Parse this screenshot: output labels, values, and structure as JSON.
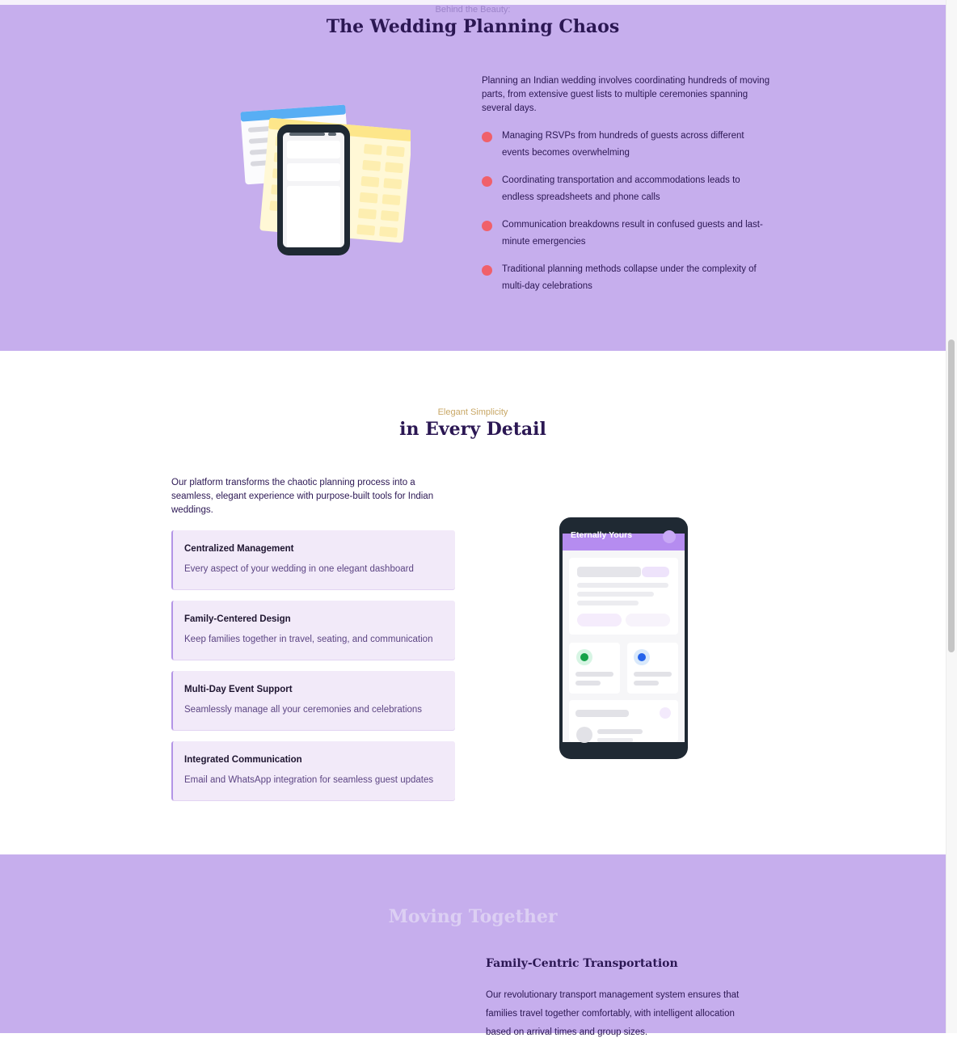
{
  "chaos": {
    "eyebrow": "Behind the Beauty:",
    "title": "The Wedding Planning Chaos",
    "intro": "Planning an Indian wedding involves coordinating hundreds of moving parts, from extensive guest lists to multiple ceremonies spanning several days.",
    "bullets": [
      "Managing RSVPs from hundreds of guests across different events becomes overwhelming",
      "Coordinating transportation and accommodations leads to endless spreadsheets and phone calls",
      "Communication breakdowns result in confused guests and last-minute emergencies",
      "Traditional planning methods collapse under the complexity of multi-day celebrations"
    ]
  },
  "detail": {
    "eyebrow": "Elegant Simplicity",
    "title": "in Every Detail",
    "intro": "Our platform transforms the chaotic planning process into a seamless, elegant experience with purpose-built tools for Indian weddings.",
    "features": [
      {
        "title": "Centralized Management",
        "desc": "Every aspect of your wedding in one elegant dashboard"
      },
      {
        "title": "Family-Centered Design",
        "desc": "Keep families together in travel, seating, and communication"
      },
      {
        "title": "Multi-Day Event Support",
        "desc": "Seamlessly manage all your ceremonies and celebrations"
      },
      {
        "title": "Integrated Communication",
        "desc": "Email and WhatsApp integration for seamless guest updates"
      }
    ],
    "phone_brand": "Eternally Yours"
  },
  "moving": {
    "title": "Moving Together",
    "transport_title": "Family-Centric Transportation",
    "transport_desc": "Our revolutionary transport management system ensures that families travel together comfortably, with intelligent allocation based on arrival times and group sizes."
  },
  "colors": {
    "section_lavender": "#c6aeed",
    "accent_gold": "#c8a765",
    "bullet_red": "#f0606a",
    "card_bg": "#f2eaf9",
    "heading_dark": "#2b1753"
  }
}
